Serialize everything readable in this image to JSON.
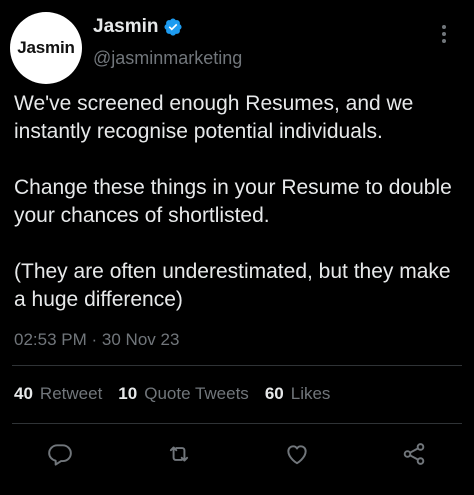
{
  "author": {
    "avatar_text": "Jasmin",
    "display_name": "Jasmin",
    "handle": "@jasminmarketing",
    "verified": true
  },
  "tweet": {
    "paragraphs": [
      "We've screened enough Resumes, and we instantly recognise potential individuals.",
      "Change these things in your Resume to double your chances of shortlisted.",
      "(They are often underestimated, but they make a huge difference)"
    ],
    "time": "02:53 PM",
    "separator": "·",
    "date": "30 Nov 23"
  },
  "stats": {
    "retweets_count": "40",
    "retweets_label": "Retweet",
    "quotes_count": "10",
    "quotes_label": "Quote Tweets",
    "likes_count": "60",
    "likes_label": "Likes"
  },
  "icons": {
    "more": "more-vertical-icon",
    "verified": "verified-badge-icon",
    "reply": "reply-icon",
    "retweet": "retweet-icon",
    "like": "heart-icon",
    "share": "share-icon"
  },
  "colors": {
    "background": "#000000",
    "text_primary": "#e7e9ea",
    "text_secondary": "#71767b",
    "verified": "#1d9bf0",
    "divider": "#2f3336"
  }
}
